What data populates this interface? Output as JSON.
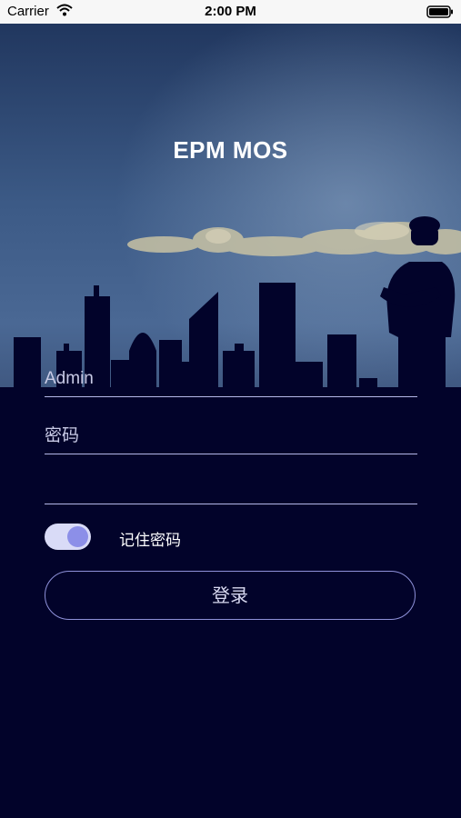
{
  "status_bar": {
    "carrier": "Carrier",
    "time": "2:00 PM"
  },
  "app": {
    "title": "EPM MOS"
  },
  "form": {
    "username_placeholder": "Admin",
    "password_placeholder": "密码",
    "extra_placeholder": "",
    "remember_label": "记住密码",
    "remember_checked": true,
    "login_label": "登录"
  },
  "colors": {
    "background": "#02032a",
    "accent": "#8c8fe8",
    "underline": "#b5b8e8"
  },
  "icons": [
    "wifi-icon",
    "battery-icon"
  ]
}
